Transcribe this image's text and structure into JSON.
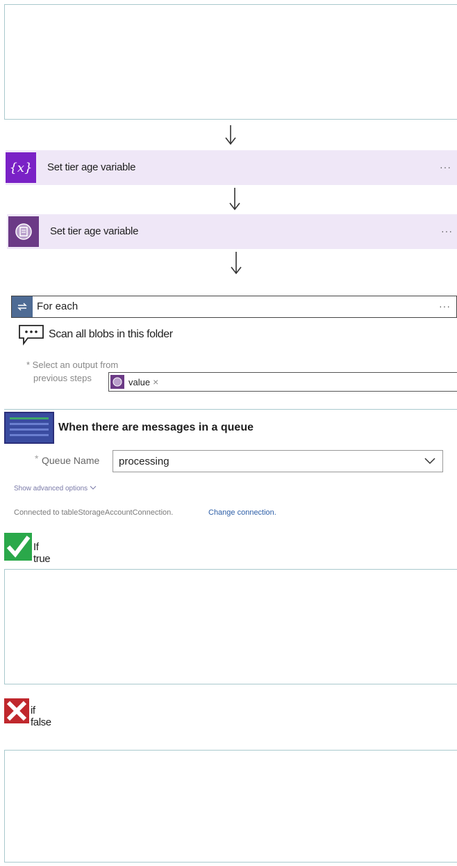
{
  "steps": {
    "set_variable_1": {
      "title": "Set tier age variable",
      "icon": "variable-icon",
      "menu": "···",
      "icon_glyph": "{x}"
    },
    "set_variable_2": {
      "title": "Set tier age variable",
      "icon": "expression-icon",
      "menu": "···"
    },
    "for_each": {
      "title": "For each",
      "menu": "···",
      "comment": "Scan all blobs in this folder",
      "select_label_line1": "* Select an output from",
      "select_label_line2": "previous steps",
      "token": {
        "text": "value",
        "remove": "×"
      }
    },
    "queue_trigger": {
      "title": "When there are messages in a queue",
      "required_mark": "*",
      "queue_label": "Queue Name",
      "queue_value": "processing",
      "advanced_options": "Show advanced options",
      "connected_text": "Connected to tableStorageAccountConnection.",
      "change_connection": "Change connection."
    },
    "if_true": {
      "label": "If true"
    },
    "if_false": {
      "label": "if false"
    }
  },
  "colors": {
    "variable_card_bg": "#efe7f7",
    "variable_icon_bg": "#7a21c6",
    "expression_icon_bg": "#6b3a86",
    "foreach_icon_bg": "#4e6b94",
    "queue_icon_bg": "#3a4ca0",
    "link": "#2e5fa8",
    "check_green": "#2aa84a",
    "cross_red": "#c0282d"
  }
}
